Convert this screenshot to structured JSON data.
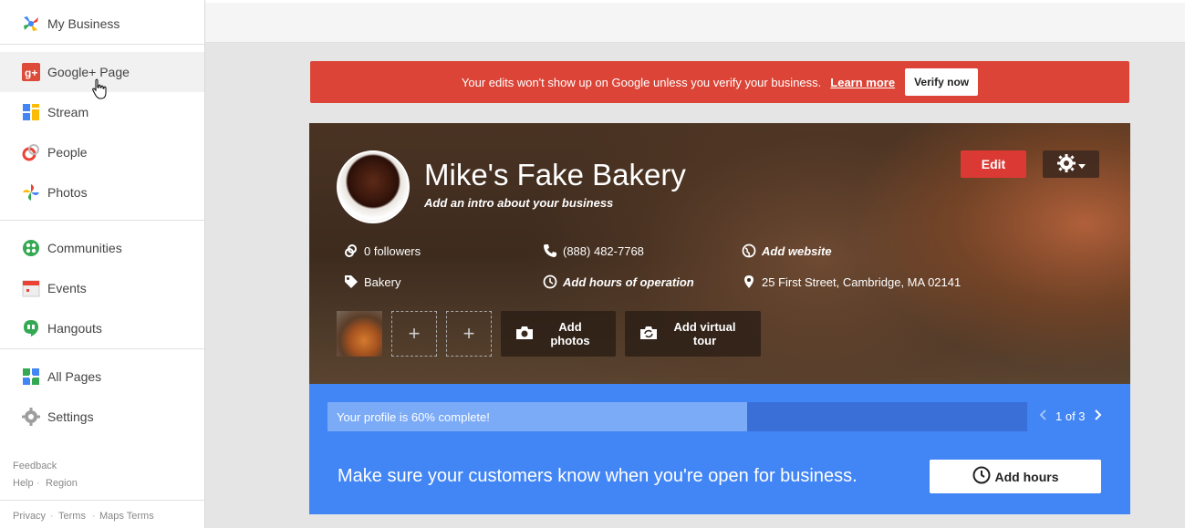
{
  "sidebar": {
    "top": {
      "label": "My Business"
    },
    "items": [
      {
        "label": "Google+ Page"
      },
      {
        "label": "Stream"
      },
      {
        "label": "People"
      },
      {
        "label": "Photos"
      },
      {
        "label": "Communities"
      },
      {
        "label": "Events"
      },
      {
        "label": "Hangouts"
      },
      {
        "label": "All Pages"
      },
      {
        "label": "Settings"
      }
    ],
    "footer": {
      "feedback": "Feedback",
      "help": "Help",
      "region": "Region",
      "privacy": "Privacy",
      "terms": "Terms",
      "maps_terms": "Maps Terms",
      "sep": "·"
    }
  },
  "alert": {
    "message": "Your edits won't show up on Google unless you verify your business.",
    "learn_more": "Learn more",
    "verify": "Verify now"
  },
  "business": {
    "name": "Mike's Fake Bakery",
    "intro": "Add an intro about your business",
    "edit": "Edit",
    "followers": "0 followers",
    "phone": "(888) 482-7768",
    "website": "Add website",
    "category": "Bakery",
    "hours": "Add hours of operation",
    "address": "25 First Street, Cambridge, MA 02141",
    "add_thumb": "+",
    "add_photos": "Add photos",
    "add_tour": "Add virtual tour"
  },
  "profile": {
    "progress_text": "Your profile is 60% complete!",
    "progress": 0.6,
    "pager": "1 of 3",
    "tip": "Make sure your customers know when you're open for business.",
    "add_hours": "Add hours"
  },
  "colors": {
    "alert": "#db4437",
    "blue": "#4285f4",
    "edit": "#db3a34"
  }
}
